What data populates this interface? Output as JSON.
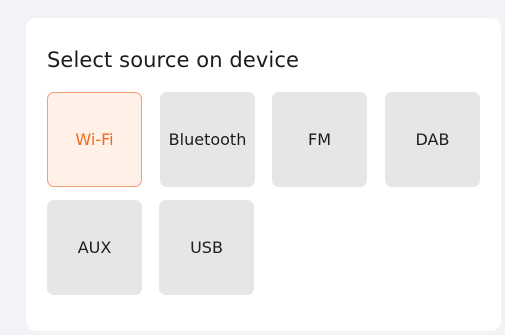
{
  "panel": {
    "title": "Select source on device"
  },
  "sources": [
    {
      "label": "Wi-Fi",
      "selected": true
    },
    {
      "label": "Bluetooth",
      "selected": false
    },
    {
      "label": "FM",
      "selected": false
    },
    {
      "label": "DAB",
      "selected": false
    },
    {
      "label": "AUX",
      "selected": false
    },
    {
      "label": "USB",
      "selected": false
    }
  ],
  "colors": {
    "selected_text": "#f26b1d",
    "selected_bg": "#fff0e8",
    "selected_border": "#f4a077",
    "button_bg": "#e6e6e6",
    "page_bg": "#f2f2f7"
  }
}
